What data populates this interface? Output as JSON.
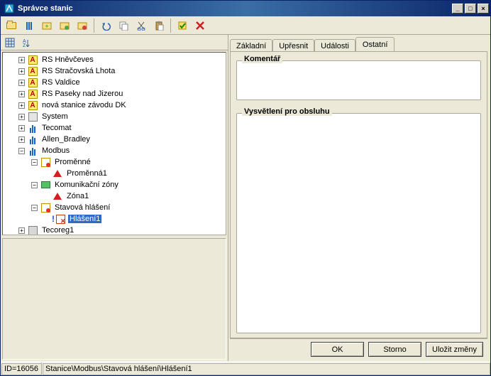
{
  "window": {
    "title": "Správce stanic"
  },
  "winbtns": {
    "min": "_",
    "max": "□",
    "close": "×"
  },
  "tree": {
    "items": [
      {
        "indent": 1,
        "exp": "+",
        "icon": "A",
        "label": "RS Hněvčeves"
      },
      {
        "indent": 1,
        "exp": "+",
        "icon": "A",
        "label": "RS Stračovská Lhota"
      },
      {
        "indent": 1,
        "exp": "+",
        "icon": "A",
        "label": "RS Valdice"
      },
      {
        "indent": 1,
        "exp": "+",
        "icon": "A",
        "label": "RS Paseky nad Jizerou"
      },
      {
        "indent": 1,
        "exp": "+",
        "icon": "A",
        "label": "nová stanice závodu DK"
      },
      {
        "indent": 1,
        "exp": "+",
        "icon": "sys",
        "label": "System"
      },
      {
        "indent": 1,
        "exp": "+",
        "icon": "bars",
        "label": "Tecomat"
      },
      {
        "indent": 1,
        "exp": "+",
        "icon": "bars",
        "label": "Allen_Bradley"
      },
      {
        "indent": 1,
        "exp": "-",
        "icon": "bars",
        "label": "Modbus"
      },
      {
        "indent": 2,
        "exp": "-",
        "icon": "vars",
        "label": "Proměnné"
      },
      {
        "indent": 3,
        "exp": "",
        "icon": "tri",
        "label": "Proměnná1"
      },
      {
        "indent": 2,
        "exp": "-",
        "icon": "zone",
        "label": "Komunikační zóny"
      },
      {
        "indent": 3,
        "exp": "",
        "icon": "tri",
        "label": "Zóna1"
      },
      {
        "indent": 2,
        "exp": "-",
        "icon": "vars",
        "label": "Stavová hlášení"
      },
      {
        "indent": 3,
        "exp": "",
        "icon": "err",
        "label": "Hlášení1",
        "selected": true,
        "pre": "excl"
      },
      {
        "indent": 1,
        "exp": "+",
        "icon": "modbus",
        "label": "Tecoreg1"
      }
    ]
  },
  "tabs": {
    "t0": "Základní",
    "t1": "Upřesnit",
    "t2": "Události",
    "t3": "Ostatní",
    "active": 3
  },
  "groups": {
    "comment": "Komentář",
    "explain": "Vysvětlení pro obsluhu"
  },
  "buttons": {
    "ok": "OK",
    "cancel": "Storno",
    "save": "Uložit změny"
  },
  "status": {
    "id": "ID=16056",
    "path": "Stanice\\Modbus\\Stavová hlášení\\Hlášení1"
  }
}
